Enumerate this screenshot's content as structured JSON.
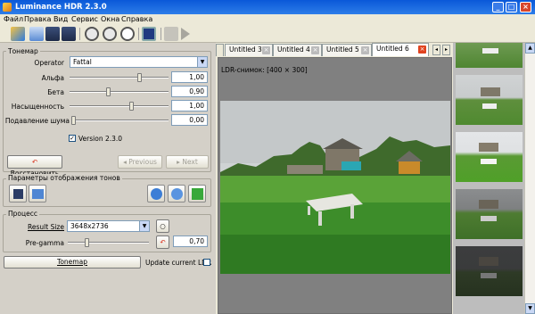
{
  "window": {
    "title": "Luminance HDR 2.3.0"
  },
  "menu": [
    "Файл",
    "Правка",
    "Вид",
    "Сервис",
    "Окна",
    "Справка"
  ],
  "tonemap": {
    "group_title": "Тонемар",
    "operator_label": "Operator",
    "operator_value": "Fattal",
    "params": [
      {
        "label": "Альфа",
        "value": "1,00",
        "level": 0.72
      },
      {
        "label": "Бета",
        "value": "0,90",
        "level": 0.39
      },
      {
        "label": "Насыщенность",
        "value": "1,00",
        "level": 0.63
      },
      {
        "label": "Подавление шума",
        "value": "0,00",
        "level": 0.0
      }
    ],
    "version_checkbox": {
      "label": "Version 2.3.0",
      "checked": true
    },
    "restore_label": "Восстановить",
    "previous_label": "Previous",
    "next_label": "Next"
  },
  "display_params": {
    "group_title": "Параметры отображения тонов"
  },
  "process": {
    "group_title": "Процесс",
    "result_size_label": "Result Size",
    "result_size_value": "3648x2736",
    "pregamma_label": "Pre-gamma",
    "pregamma_value": "0,70",
    "pregamma_level": 0.22
  },
  "bottom": {
    "tonemap_button": "Tonemap",
    "update_ldr_label": "Update current LDR",
    "update_ldr_checked": false
  },
  "tabs": [
    "Untitled 3",
    "Untitled 4",
    "Untitled 5",
    "Untitled 6"
  ],
  "active_tab": "Untitled 6",
  "image_caption": "LDR-снимок: [400 × 300]",
  "colors": {
    "titlebar": "#0a58d8",
    "close": "#e0431f"
  }
}
